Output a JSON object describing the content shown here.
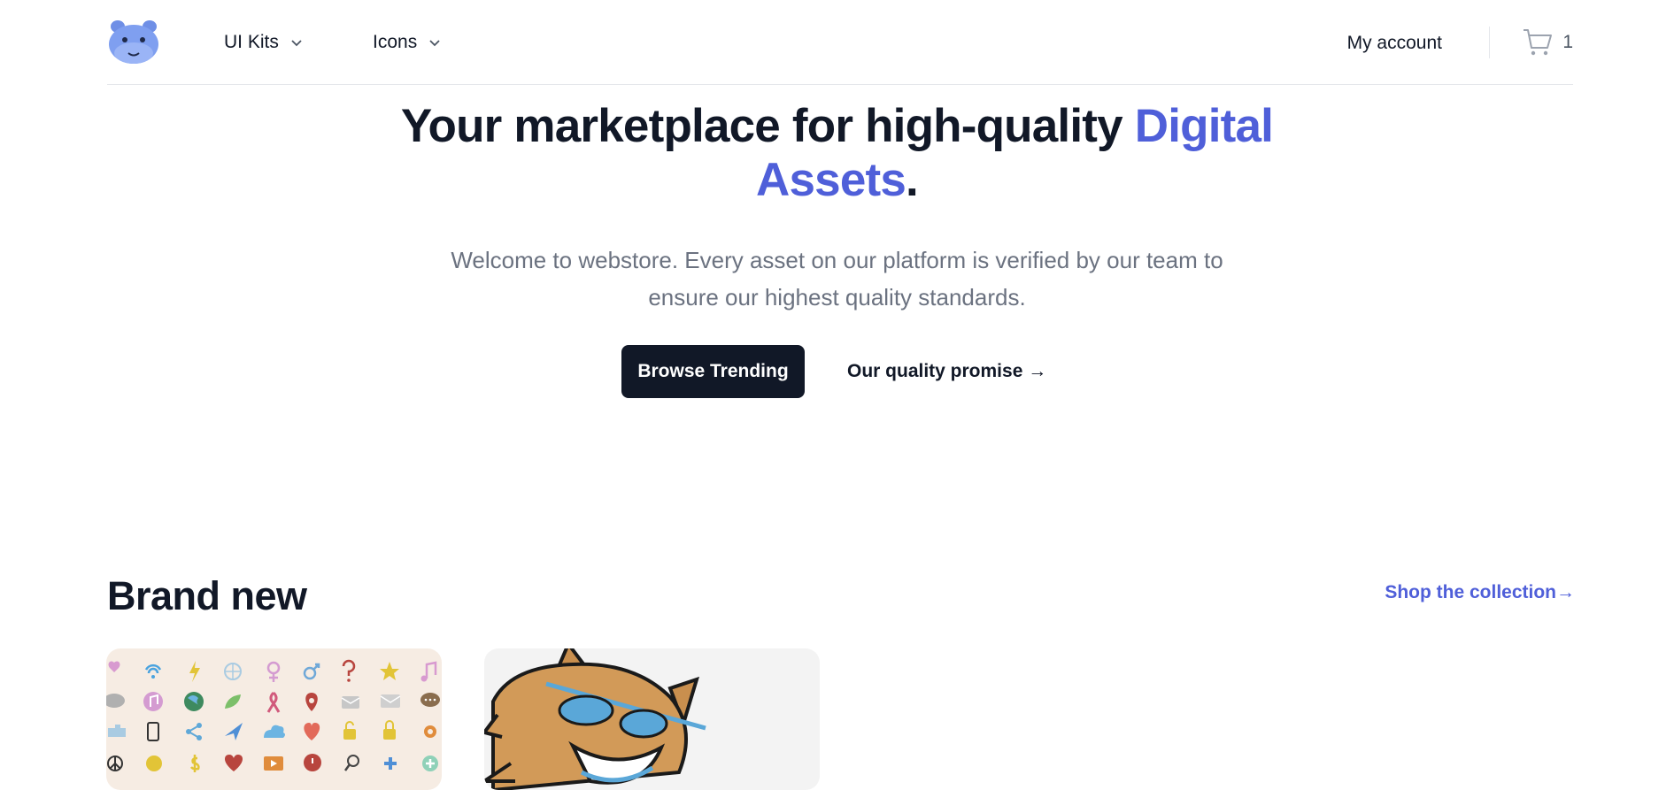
{
  "header": {
    "logo_alt": "hippo-logo",
    "nav": [
      {
        "label": "UI Kits"
      },
      {
        "label": "Icons"
      }
    ],
    "account_label": "My account",
    "cart_count": "1"
  },
  "hero": {
    "title_main": "Your marketplace for high-quality ",
    "title_accent": "Digital Assets",
    "title_end": ".",
    "subtitle": "Welcome to webstore. Every asset on our platform is verified by our team to ensure our highest quality standards.",
    "primary_button": "Browse Trending",
    "secondary_link": "Our quality promise →"
  },
  "brand_new": {
    "title": "Brand new",
    "shop_link": "Shop the collection→",
    "products": [
      {
        "name": "icon-set-product"
      },
      {
        "name": "cartoon-cat-product"
      }
    ]
  },
  "colors": {
    "accent": "#4f5fd9",
    "dark": "#111827",
    "muted": "#6b7280"
  }
}
